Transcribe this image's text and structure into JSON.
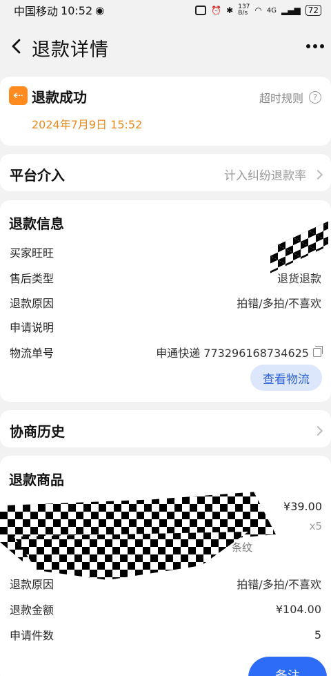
{
  "status_bar": {
    "carrier": "中国移动",
    "time": "10:52",
    "net_speed": "137\nB/s",
    "signal": "4G",
    "battery": "72"
  },
  "nav": {
    "title": "退款详情"
  },
  "status_card": {
    "title": "退款成功",
    "time": "2024年7月9日 15:52",
    "timeout_rule": "超时规则",
    "accent": "#ff8a1f"
  },
  "platform": {
    "label": "平台介入",
    "value": "计入纠纷退款率"
  },
  "refund_info": {
    "title": "退款信息",
    "buyer_label": "买家旺旺",
    "aftersale_label": "售后类型",
    "aftersale_value": "退货退款",
    "reason_label": "退款原因",
    "reason_value": "拍错/多拍/不喜欢",
    "note_label": "申请说明",
    "logistics_label": "物流单号",
    "logistics_value": "申通快递 773296168734625",
    "view_logistics": "查看物流"
  },
  "history": {
    "title": "协商历史"
  },
  "refund_goods": {
    "title": "退款商品",
    "price": "¥39.00",
    "qty": "x5",
    "variant_partial": "条纹",
    "reason_label": "退款原因",
    "reason_value": "拍错/多拍/不喜欢",
    "amount_label": "退款金额",
    "amount_value": "¥104.00",
    "count_label": "申请件数",
    "count_value": "5"
  },
  "bottom": {
    "note_button": "备注"
  }
}
